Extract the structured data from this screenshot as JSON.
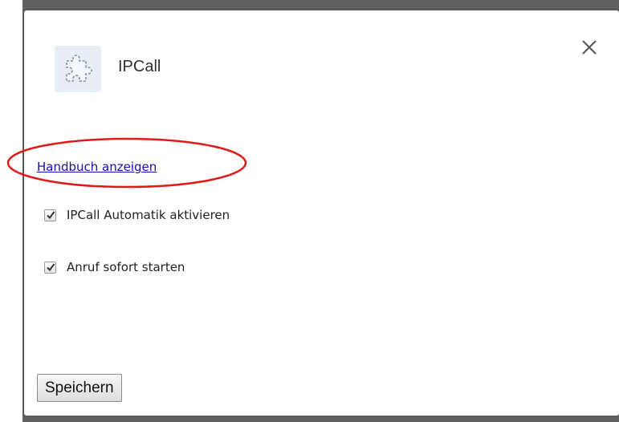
{
  "dialog": {
    "title": "IPCall",
    "extension_icon": "puzzle-piece-icon",
    "close_icon": "close-icon"
  },
  "options": {
    "manual_link": "Handbuch anzeigen",
    "highlight_color": "#e01919",
    "checkboxes": [
      {
        "label": "IPCall Automatik aktivieren",
        "checked": true
      },
      {
        "label": "Anruf sofort starten",
        "checked": true
      }
    ]
  },
  "footer": {
    "save_label": "Speichern"
  }
}
